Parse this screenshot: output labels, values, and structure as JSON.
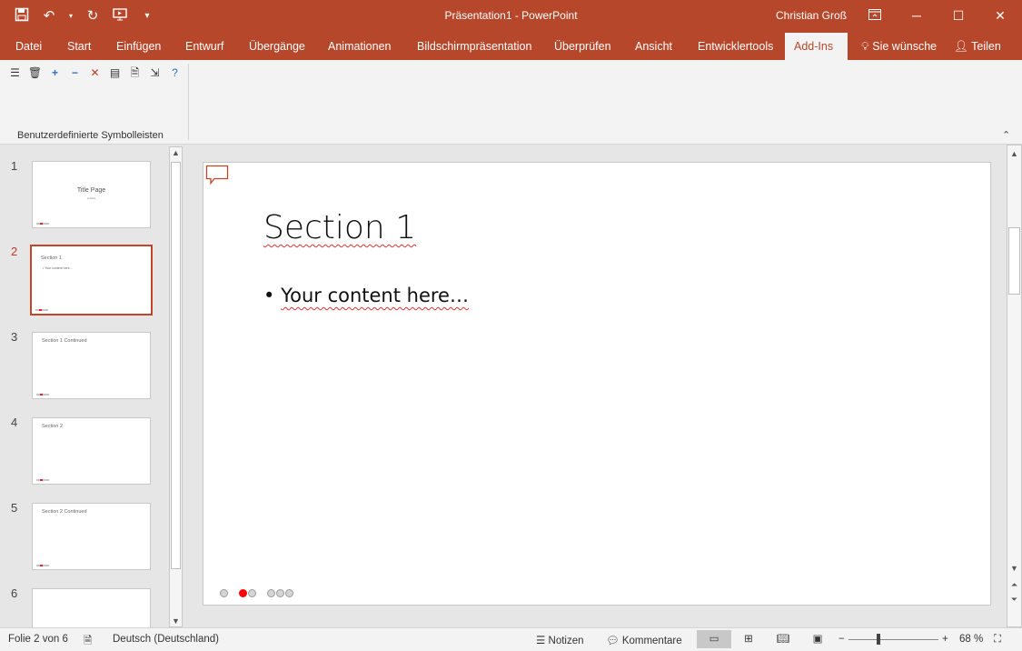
{
  "window": {
    "title": "Präsentation1  -  PowerPoint",
    "user": "Christian Groß"
  },
  "tabs": [
    "Datei",
    "Start",
    "Einfügen",
    "Entwurf",
    "Übergänge",
    "Animationen",
    "Bildschirmpräsentation",
    "Überprüfen",
    "Ansicht",
    "Entwicklertools",
    "Add-Ins"
  ],
  "active_tab": "Add-Ins",
  "tell_me": "Sie wünsche",
  "share": "Teilen",
  "ribbon": {
    "group_label": "Benutzerdefinierte Symbolleisten"
  },
  "thumbnails": [
    {
      "number": "1",
      "title": "Title Page",
      "subtitle": "subtitle"
    },
    {
      "number": "2",
      "title": "Section 1",
      "bullet": "• Your content here..."
    },
    {
      "number": "3",
      "title": "Section 1 Continued"
    },
    {
      "number": "4",
      "title": "Section 2"
    },
    {
      "number": "5",
      "title": "Section 2 Continued"
    },
    {
      "number": "6",
      "title": ""
    }
  ],
  "slide": {
    "title": "Section 1",
    "bullet": "Your content here…"
  },
  "status": {
    "slide_counter": "Folie 2 von 6",
    "language": "Deutsch (Deutschland)",
    "notes": "Notizen",
    "comments": "Kommentare",
    "zoom": "68 %"
  },
  "colors": {
    "accent": "#b7472a",
    "nav_dot_active": "#ff0000"
  }
}
